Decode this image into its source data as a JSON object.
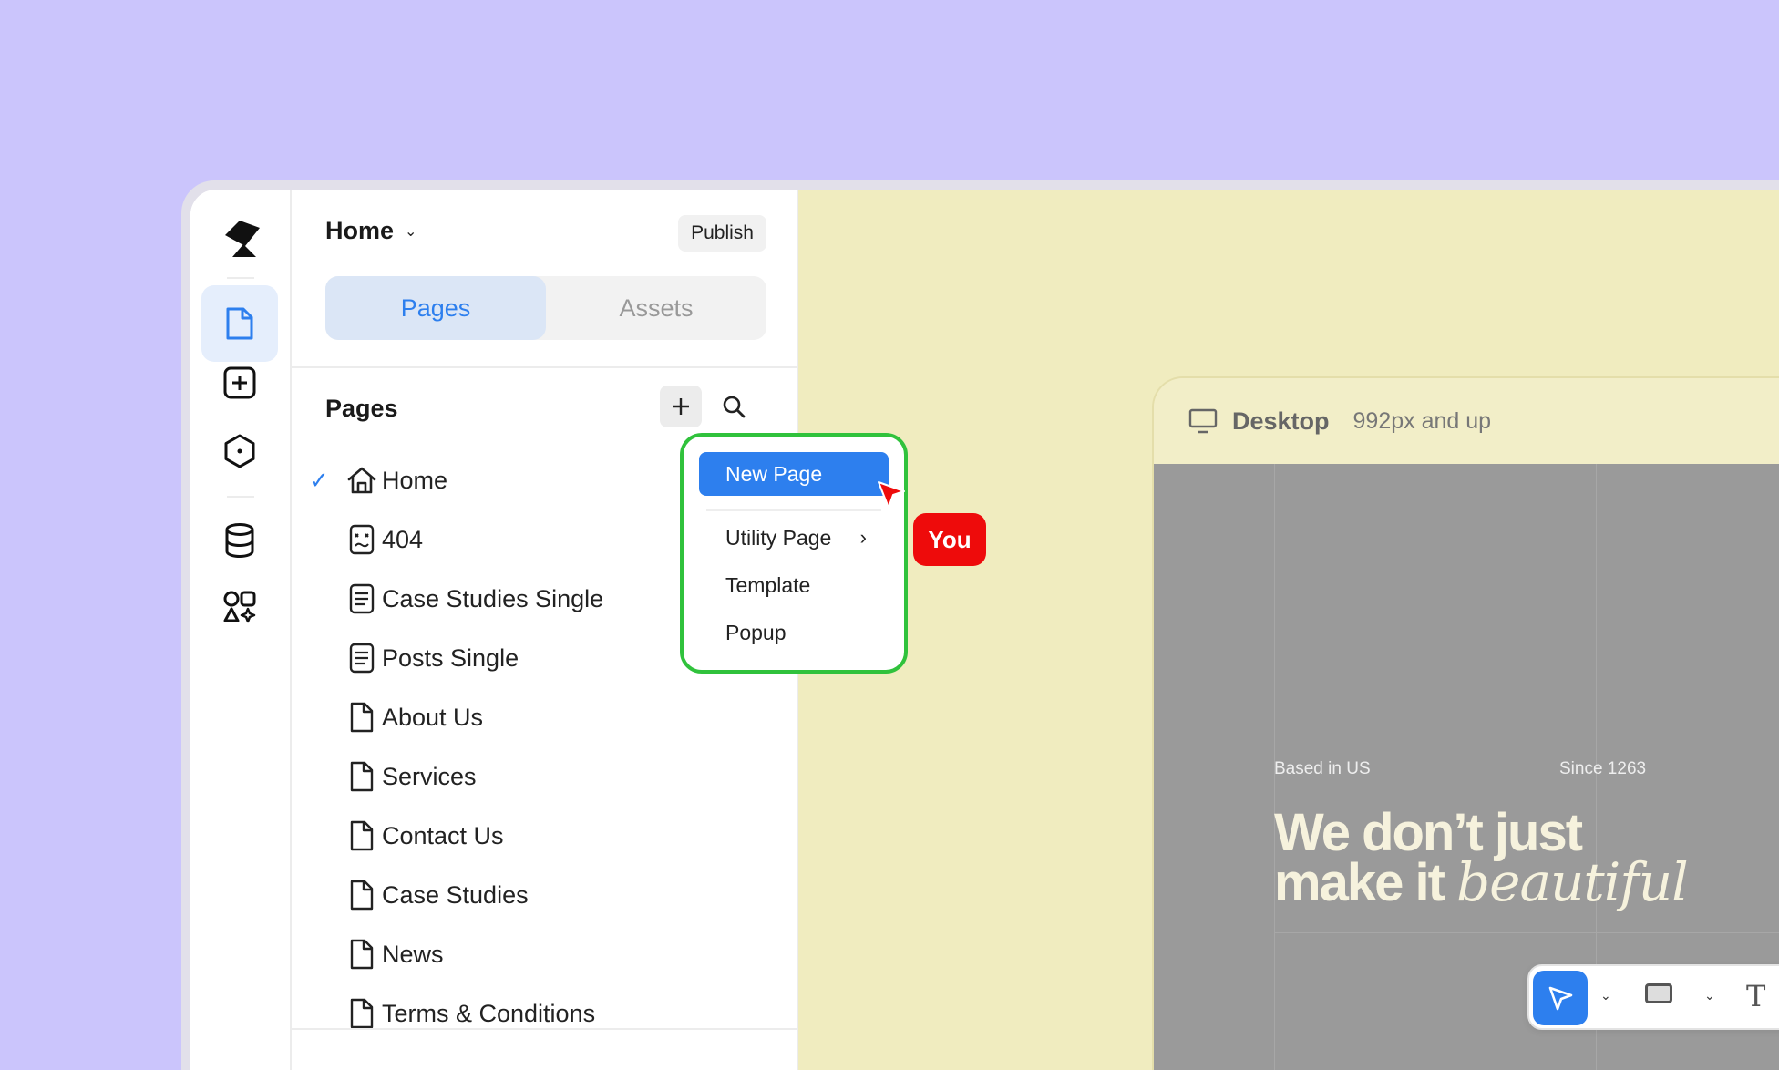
{
  "header": {
    "page_title": "Home",
    "publish_label": "Publish"
  },
  "tabs": [
    {
      "label": "Pages",
      "active": true
    },
    {
      "label": "Assets",
      "active": false
    }
  ],
  "pages_section": {
    "title": "Pages"
  },
  "pages": [
    {
      "label": "Home",
      "icon": "home-icon",
      "selected": true
    },
    {
      "label": "404",
      "icon": "error-page-icon"
    },
    {
      "label": "Case Studies Single",
      "icon": "template-page-icon"
    },
    {
      "label": "Posts Single",
      "icon": "template-page-icon"
    },
    {
      "label": "About Us",
      "icon": "page-icon"
    },
    {
      "label": "Services",
      "icon": "page-icon"
    },
    {
      "label": "Contact Us",
      "icon": "page-icon"
    },
    {
      "label": "Case Studies",
      "icon": "page-icon"
    },
    {
      "label": "News",
      "icon": "page-icon"
    },
    {
      "label": "Terms & Conditions",
      "icon": "page-icon"
    }
  ],
  "add_menu": {
    "items": [
      {
        "label": "New Page",
        "highlighted": true
      },
      {
        "label": "Utility Page",
        "has_submenu": true
      },
      {
        "label": "Template"
      },
      {
        "label": "Popup"
      }
    ]
  },
  "cursor_label": "You",
  "canvas": {
    "breakpoint_label": "Desktop",
    "breakpoint_range": "992px and up",
    "hero_left_caption": "Based in US",
    "hero_right_caption": "Since 1263",
    "hero_line1": "We don’t just",
    "hero_line2_plain": "make it",
    "hero_line2_italic": "beautiful"
  },
  "colors": {
    "background": "#cbc5fc",
    "accent": "#2d7fee",
    "canvas": "#f0ecbf",
    "menu_highlight_border": "#30c23c",
    "you_badge": "#ee0b0b"
  }
}
